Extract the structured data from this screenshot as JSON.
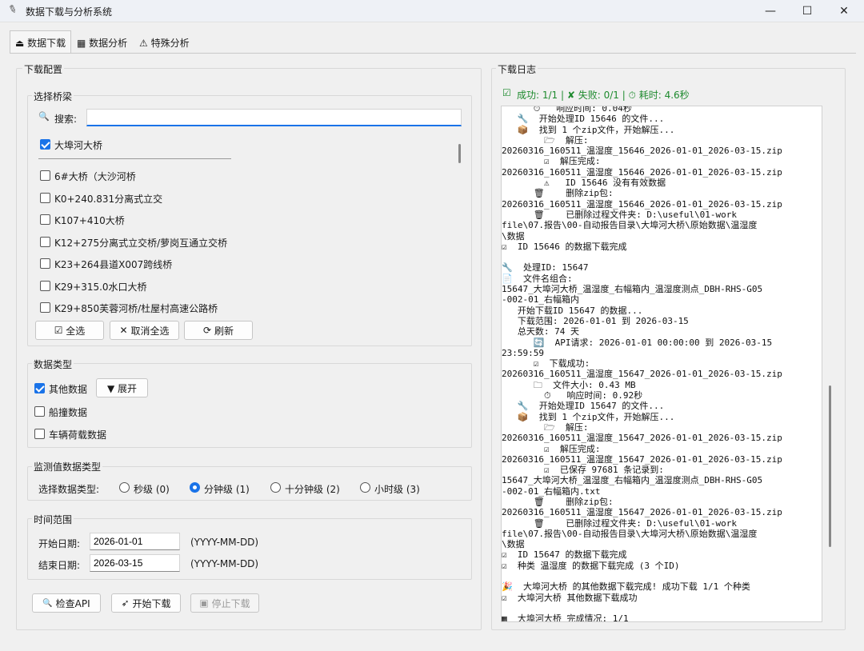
{
  "window": {
    "title": "数据下载与分析系统",
    "minimize": "—",
    "maximize": "☐",
    "close": "✕"
  },
  "tabs": [
    {
      "icon": "⏏",
      "label": "数据下载"
    },
    {
      "icon": "▦",
      "label": "数据分析"
    },
    {
      "icon": "⚠",
      "label": "特殊分析"
    }
  ],
  "config": {
    "title": "下载配置",
    "bridge": {
      "title": "选择桥梁",
      "search_label": "搜索:",
      "search_value": "",
      "top_item": "大埠河大桥",
      "items": [
        "6#大桥（大沙河桥",
        "K0+240.831分离式立交",
        "K107+410大桥",
        "K12+275分离式立交桥/萝岗互通立交桥",
        "K23+264县道X007跨线桥",
        "K29+315.0水口大桥",
        "K29+850芙蓉河桥/杜屋村高速公路桥"
      ],
      "select_all": "全选",
      "deselect_all": "取消全选",
      "refresh": "刷新"
    },
    "data_type": {
      "title": "数据类型",
      "other": "其他数据",
      "expand": "▼ 展开",
      "ship": "船撞数据",
      "vehicle": "车辆荷载数据"
    },
    "monitor": {
      "title": "监测值数据类型",
      "label": "选择数据类型:",
      "options": [
        "秒级 (0)",
        "分钟级 (1)",
        "十分钟级 (2)",
        "小时级 (3)"
      ]
    },
    "time": {
      "title": "时间范围",
      "start_label": "开始日期:",
      "start_value": "2026-01-01",
      "end_label": "结束日期:",
      "end_value": "2026-03-15",
      "format": "(YYYY-MM-DD)"
    },
    "actions": {
      "check_api": "检查API",
      "start": "开始下载",
      "stop": "停止下载"
    }
  },
  "log": {
    "title": "下载日志",
    "status": "成功: 1/1 | ✘ 失败: 0/1 | ⏱ 耗时: 4.6秒",
    "text": "      ⏱   响应时间: 0.04秒\n   🔧  开始处理ID 15646 的文件...\n   📦  找到 1 个zip文件，开始解压...\n        🗁  解压:\n20260316_160511_温湿度_15646_2026-01-01_2026-03-15.zip\n        ☑  解压完成:\n20260316_160511_温湿度_15646_2026-01-01_2026-03-15.zip\n        ⚠   ID 15646 没有有效数据\n      🗑    删除zip包:\n20260316_160511_温湿度_15646_2026-01-01_2026-03-15.zip\n      🗑    已删除过程文件夹: D:\\useful\\01-work\nfile\\07.报告\\00-自动报告目录\\大埠河大桥\\原始数据\\温湿度\n\\数据\n☑  ID 15646 的数据下载完成\n\n🔧  处理ID: 15647\n📄  文件名组合:\n15647_大埠河大桥_温湿度_右幅箱内_温湿度测点_DBH-RHS-G05\n-002-01_右幅箱内\n   开始下载ID 15647 的数据...\n   下载范围: 2026-01-01 到 2026-03-15\n   总天数: 74 天\n      🔄  API请求: 2026-01-01 00:00:00 到 2026-03-15\n23:59:59\n      ☑  下载成功:\n20260316_160511_温湿度_15647_2026-01-01_2026-03-15.zip\n      🗀  文件大小: 0.43 MB\n        ⏱   响应时间: 0.92秒\n   🔧  开始处理ID 15647 的文件...\n   📦  找到 1 个zip文件，开始解压...\n        🗁  解压:\n20260316_160511_温湿度_15647_2026-01-01_2026-03-15.zip\n        ☑  解压完成:\n20260316_160511_温湿度_15647_2026-01-01_2026-03-15.zip\n        ☑  已保存 97681 条记录到:\n15647_大埠河大桥_温湿度_右幅箱内_温湿度测点_DBH-RHS-G05\n-002-01_右幅箱内.txt\n      🗑    删除zip包:\n20260316_160511_温湿度_15647_2026-01-01_2026-03-15.zip\n      🗑    已删除过程文件夹: D:\\useful\\01-work\nfile\\07.报告\\00-自动报告目录\\大埠河大桥\\原始数据\\温湿度\n\\数据\n☑  ID 15647 的数据下载完成\n☑  种类 温湿度 的数据下载完成 (3 个ID)\n\n🎉  大埠河大桥 的其他数据下载完成! 成功下载 1/1 个种类\n☑  大埠河大桥 其他数据下载成功\n\n▦  大埠河大桥 完成情况: 1/1"
  },
  "colors": {
    "accent": "#1a73e8",
    "status_green": "#1e8a2e"
  }
}
